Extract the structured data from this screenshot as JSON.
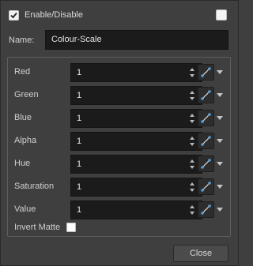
{
  "header": {
    "enable_label": "Enable/Disable",
    "enable_checked": true,
    "extra_checkbox_checked": false
  },
  "name": {
    "label": "Name:",
    "value": "Colour-Scale"
  },
  "params": [
    {
      "label": "Red",
      "value": "1",
      "icon": "link-curve-icon"
    },
    {
      "label": "Green",
      "value": "1",
      "icon": "link-curve-icon"
    },
    {
      "label": "Blue",
      "value": "1",
      "icon": "link-curve-icon"
    },
    {
      "label": "Alpha",
      "value": "1",
      "icon": "link-curve-icon"
    },
    {
      "label": "Hue",
      "value": "1",
      "icon": "link-curve-icon"
    },
    {
      "label": "Saturation",
      "value": "1",
      "icon": "link-curve-icon"
    },
    {
      "label": "Value",
      "value": "1",
      "icon": "link-curve-icon"
    }
  ],
  "invert": {
    "label": "Invert Matte",
    "checked": false
  },
  "buttons": {
    "close_label": "Close"
  },
  "colors": {
    "background": "#3f3f3f",
    "field": "#1b1b1b",
    "accent": "#5a9fd6"
  }
}
